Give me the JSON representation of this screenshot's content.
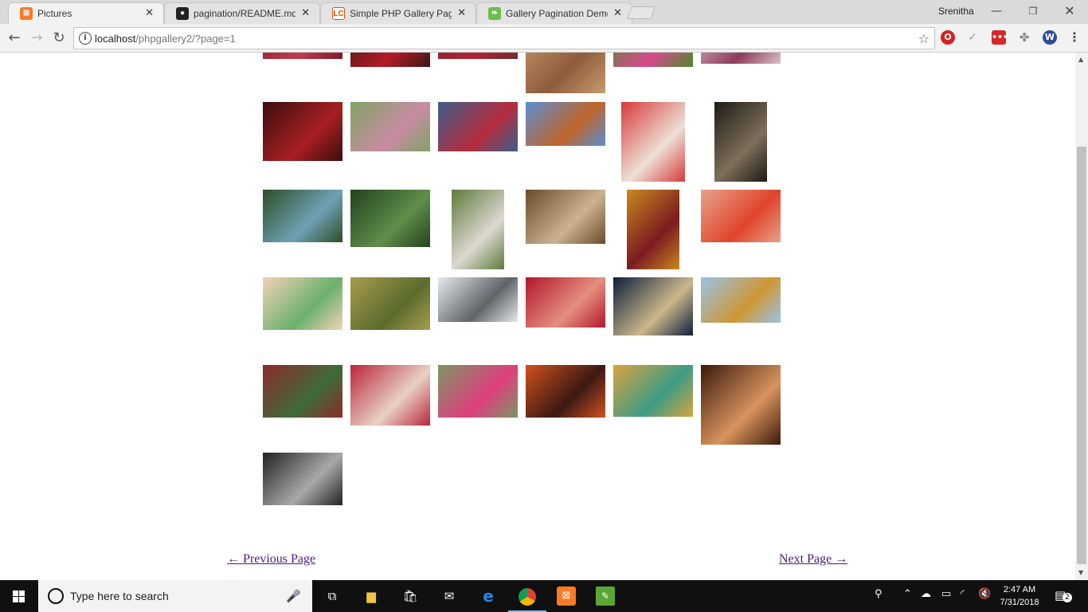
{
  "browser": {
    "tabs": [
      {
        "title": "Pictures",
        "favicon": "xampp-icon",
        "color": "#fb7a24",
        "glyph": "⊠"
      },
      {
        "title": "pagination/README.md a",
        "favicon": "github-icon",
        "color": "#222222",
        "glyph": "●"
      },
      {
        "title": "Simple PHP Gallery Pagin",
        "favicon": "lc-icon",
        "color": "#ffffff",
        "glyph": "LC"
      },
      {
        "title": "Gallery Pagination Demo",
        "favicon": "leaf-icon",
        "color": "#6cbf4a",
        "glyph": "❧"
      }
    ],
    "profile_name": "Srenitha",
    "url_host": "localhost",
    "url_rest": "/phpgallery2/?page=1"
  },
  "gallery": {
    "images": [
      {
        "label": "row-0-col-0",
        "colors": [
          "#7a1a2a",
          "#c43b4f"
        ]
      },
      {
        "label": "row-0-col-1",
        "colors": [
          "#3a1818",
          "#b31b26"
        ]
      },
      {
        "label": "row-0-col-2",
        "colors": [
          "#6e2b31",
          "#b32233"
        ]
      },
      {
        "label": "row-0-col-3",
        "colors": [
          "#c89b6f",
          "#8e5c3b"
        ]
      },
      {
        "label": "row-0-col-4",
        "colors": [
          "#4c8a2a",
          "#d64b8c"
        ]
      },
      {
        "label": "row-0-col-5",
        "colors": [
          "#d9c2c6",
          "#8e3b5e"
        ]
      },
      {
        "label": "row-1-col-0",
        "colors": [
          "#3a0e10",
          "#a81f22"
        ]
      },
      {
        "label": "row-1-col-1",
        "colors": [
          "#7fa365",
          "#c98ca3"
        ]
      },
      {
        "label": "row-1-col-2",
        "colors": [
          "#3c5f8c",
          "#b62c3c"
        ]
      },
      {
        "label": "row-1-col-3",
        "colors": [
          "#5a8ed0",
          "#c0652a"
        ]
      },
      {
        "label": "row-1-col-4",
        "colors": [
          "#d73a3a",
          "#ece0d6"
        ]
      },
      {
        "label": "row-1-col-5",
        "colors": [
          "#1d1a15",
          "#7d6f5a"
        ]
      },
      {
        "label": "row-2-col-0",
        "colors": [
          "#2e4e26",
          "#6ea1b6"
        ]
      },
      {
        "label": "row-2-col-1",
        "colors": [
          "#23401f",
          "#5f8f4a"
        ]
      },
      {
        "label": "row-2-col-2",
        "colors": [
          "#5c7a3a",
          "#ded8d2"
        ]
      },
      {
        "label": "row-2-col-3",
        "colors": [
          "#6a4a2c",
          "#cbb28f"
        ]
      },
      {
        "label": "row-2-col-4",
        "colors": [
          "#c78a1c",
          "#7c1a22"
        ]
      },
      {
        "label": "row-2-col-5",
        "colors": [
          "#e7a28c",
          "#e0442a"
        ]
      },
      {
        "label": "row-3-col-0",
        "colors": [
          "#f3d2b9",
          "#6ab16b"
        ]
      },
      {
        "label": "row-3-col-1",
        "colors": [
          "#a89c4f",
          "#5b6b2c"
        ]
      },
      {
        "label": "row-3-col-2",
        "colors": [
          "#e5e9ee",
          "#5f6469"
        ]
      },
      {
        "label": "row-3-col-3",
        "colors": [
          "#b1162b",
          "#e58f7e"
        ]
      },
      {
        "label": "row-3-col-4",
        "colors": [
          "#0d1f3a",
          "#ccb78a"
        ]
      },
      {
        "label": "row-3-col-5",
        "colors": [
          "#98c3e8",
          "#cf9733"
        ]
      },
      {
        "label": "row-4-col-0",
        "colors": [
          "#8b2b2b",
          "#3e6b3a"
        ]
      },
      {
        "label": "row-4-col-1",
        "colors": [
          "#b8263a",
          "#e8d1c5"
        ]
      },
      {
        "label": "row-4-col-2",
        "colors": [
          "#7c9665",
          "#de3f7d"
        ]
      },
      {
        "label": "row-4-col-3",
        "colors": [
          "#d1501d",
          "#3b1a14"
        ]
      },
      {
        "label": "row-4-col-4",
        "colors": [
          "#d8a43e",
          "#3c9c84"
        ]
      },
      {
        "label": "row-4-col-5",
        "colors": [
          "#3a1a0c",
          "#d9935d"
        ]
      },
      {
        "label": "row-5-col-0",
        "colors": [
          "#222222",
          "#a9a9a9"
        ]
      }
    ]
  },
  "pagination": {
    "previous": "← Previous Page",
    "next": "Next Page →"
  },
  "taskbar": {
    "search_placeholder": "Type here to search",
    "time": "2:47 AM",
    "date": "7/31/2018",
    "notifications": "2"
  }
}
